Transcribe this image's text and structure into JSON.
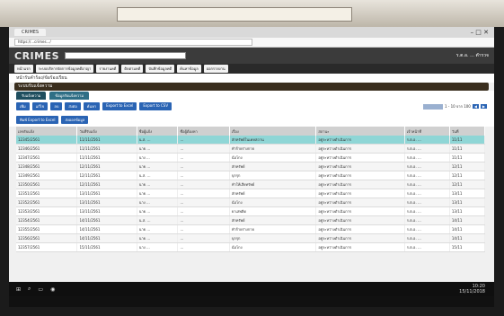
{
  "app": {
    "logo": "CRIMES",
    "user": "ร.ต.อ. ... ตำรวจ"
  },
  "browser": {
    "tab_label": "CRIMES",
    "address": "https://...crimes.../"
  },
  "menu": [
    "หน้าแรก",
    "ระบบบริหารจัดการข้อมูลคดีอาญา",
    "รายงานคดี",
    "ติดตามคดี",
    "บันทึกข้อมูลคดี",
    "ค้นหาข้อมูล",
    "ออกรายงาน"
  ],
  "breadcrumb": "หน้ารับคำร้อง/ข้อร้องเรียน",
  "section_title": "ระบบรับแจ้งความ",
  "subtabs": [
    "รับแจ้งความ",
    "ข้อมูลรับแจ้งความ"
  ],
  "toolbar": [
    "เพิ่ม",
    "แก้ไข",
    "ลบ",
    "ส่งต่อ",
    "ค้นหา",
    "Export to Excel",
    "Export to CSV"
  ],
  "toolbar2": [
    "พิมพ์ Export to Excel",
    "ส่งออกข้อมูล"
  ],
  "pager": {
    "text": "1 - 10 จาก 100"
  },
  "columns": [
    "เลขรับแจ้ง",
    "วันที่รับแจ้ง",
    "ชื่อผู้แจ้ง",
    "ชื่อผู้ต้องหา",
    "เรื่อง",
    "สถานะ",
    "เจ้าหน้าที่",
    "วันที่"
  ],
  "rows": [
    [
      "12345/2561",
      "11/11/2561",
      "น.ส. ...",
      "...",
      "ลักทรัพย์ในเคหสถาน",
      "อยู่ระหว่างดำเนินการ",
      "ร.ต.อ. ...",
      "11/11"
    ],
    [
      "12346/2561",
      "11/11/2561",
      "นาย ...",
      "...",
      "ทำร้ายร่างกาย",
      "อยู่ระหว่างดำเนินการ",
      "ร.ต.อ. ...",
      "11/11"
    ],
    [
      "12347/2561",
      "11/11/2561",
      "นาง ...",
      "...",
      "ฉ้อโกง",
      "อยู่ระหว่างดำเนินการ",
      "ร.ต.อ. ...",
      "11/11"
    ],
    [
      "12348/2561",
      "12/11/2561",
      "นาย ...",
      "...",
      "ลักทรัพย์",
      "อยู่ระหว่างดำเนินการ",
      "ร.ต.อ. ...",
      "12/11"
    ],
    [
      "12349/2561",
      "12/11/2561",
      "น.ส. ...",
      "...",
      "บุกรุก",
      "อยู่ระหว่างดำเนินการ",
      "ร.ต.อ. ...",
      "12/11"
    ],
    [
      "12350/2561",
      "12/11/2561",
      "นาย ...",
      "...",
      "ทำให้เสียทรัพย์",
      "อยู่ระหว่างดำเนินการ",
      "ร.ต.อ. ...",
      "12/11"
    ],
    [
      "12351/2561",
      "13/11/2561",
      "นาย ...",
      "...",
      "ลักทรัพย์",
      "อยู่ระหว่างดำเนินการ",
      "ร.ต.อ. ...",
      "13/11"
    ],
    [
      "12352/2561",
      "13/11/2561",
      "นาง ...",
      "...",
      "ฉ้อโกง",
      "อยู่ระหว่างดำเนินการ",
      "ร.ต.อ. ...",
      "13/11"
    ],
    [
      "12353/2561",
      "13/11/2561",
      "นาย ...",
      "...",
      "ยาเสพติด",
      "อยู่ระหว่างดำเนินการ",
      "ร.ต.อ. ...",
      "13/11"
    ],
    [
      "12354/2561",
      "14/11/2561",
      "น.ส. ...",
      "...",
      "ลักทรัพย์",
      "อยู่ระหว่างดำเนินการ",
      "ร.ต.อ. ...",
      "14/11"
    ],
    [
      "12355/2561",
      "14/11/2561",
      "นาย ...",
      "...",
      "ทำร้ายร่างกาย",
      "อยู่ระหว่างดำเนินการ",
      "ร.ต.อ. ...",
      "14/11"
    ],
    [
      "12356/2561",
      "14/11/2561",
      "นาย ...",
      "...",
      "บุกรุก",
      "อยู่ระหว่างดำเนินการ",
      "ร.ต.อ. ...",
      "14/11"
    ],
    [
      "12357/2561",
      "15/11/2561",
      "นาง ...",
      "...",
      "ฉ้อโกง",
      "อยู่ระหว่างดำเนินการ",
      "ร.ต.อ. ...",
      "15/11"
    ]
  ],
  "taskbar": {
    "clock_time": "10:20",
    "clock_date": "15/11/2018"
  }
}
